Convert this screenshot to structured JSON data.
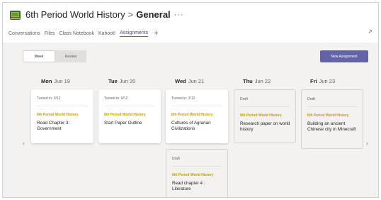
{
  "header": {
    "team_name": "6th Period World History",
    "separator": ">",
    "channel_name": "General",
    "more": "···",
    "tabs": [
      {
        "label": "Conversations"
      },
      {
        "label": "Files"
      },
      {
        "label": "Class Notebook"
      },
      {
        "label": "Kahoot!"
      },
      {
        "label": "Assignments"
      }
    ],
    "add_tab": "+",
    "expand": "↗"
  },
  "toolbar": {
    "view_week": "Week",
    "view_review": "Review",
    "new_assignment": "New Assignment"
  },
  "days": [
    {
      "dow": "Mon",
      "date": "Jun 19"
    },
    {
      "dow": "Tue",
      "date": "Jun 20"
    },
    {
      "dow": "Wed",
      "date": "Jun 21"
    },
    {
      "dow": "Thu",
      "date": "Jun 22"
    },
    {
      "dow": "Fri",
      "date": "Jun 23"
    }
  ],
  "assignments": [
    {
      "status": "Turned in: 0/12",
      "class": "6th Period World History",
      "name": "Read Chapter 3: Government"
    },
    {
      "status": "Turned in: 0/12",
      "class": "6th Period World History",
      "name": "Start Paper Outline"
    },
    {
      "status": "Turned in: 2/12",
      "class": "6th Period World History",
      "name": "Cultures of Agrarian Civilizations"
    },
    {
      "status": "Draft",
      "class": "6th Period World History",
      "name": "Read chapter 4 : Literature"
    },
    {
      "status": "Draft",
      "class": "6th Period World History",
      "name": "Research paper on world history"
    },
    {
      "status": "Draft",
      "class": "6th Period World History",
      "name": "Building an ancient Chinese city in Minecraft"
    }
  ],
  "nav": {
    "prev": "‹",
    "next": "›"
  },
  "colors": {
    "accent": "#6264a7",
    "class_label": "#c19c00",
    "canvas": "#f3f2f1"
  }
}
